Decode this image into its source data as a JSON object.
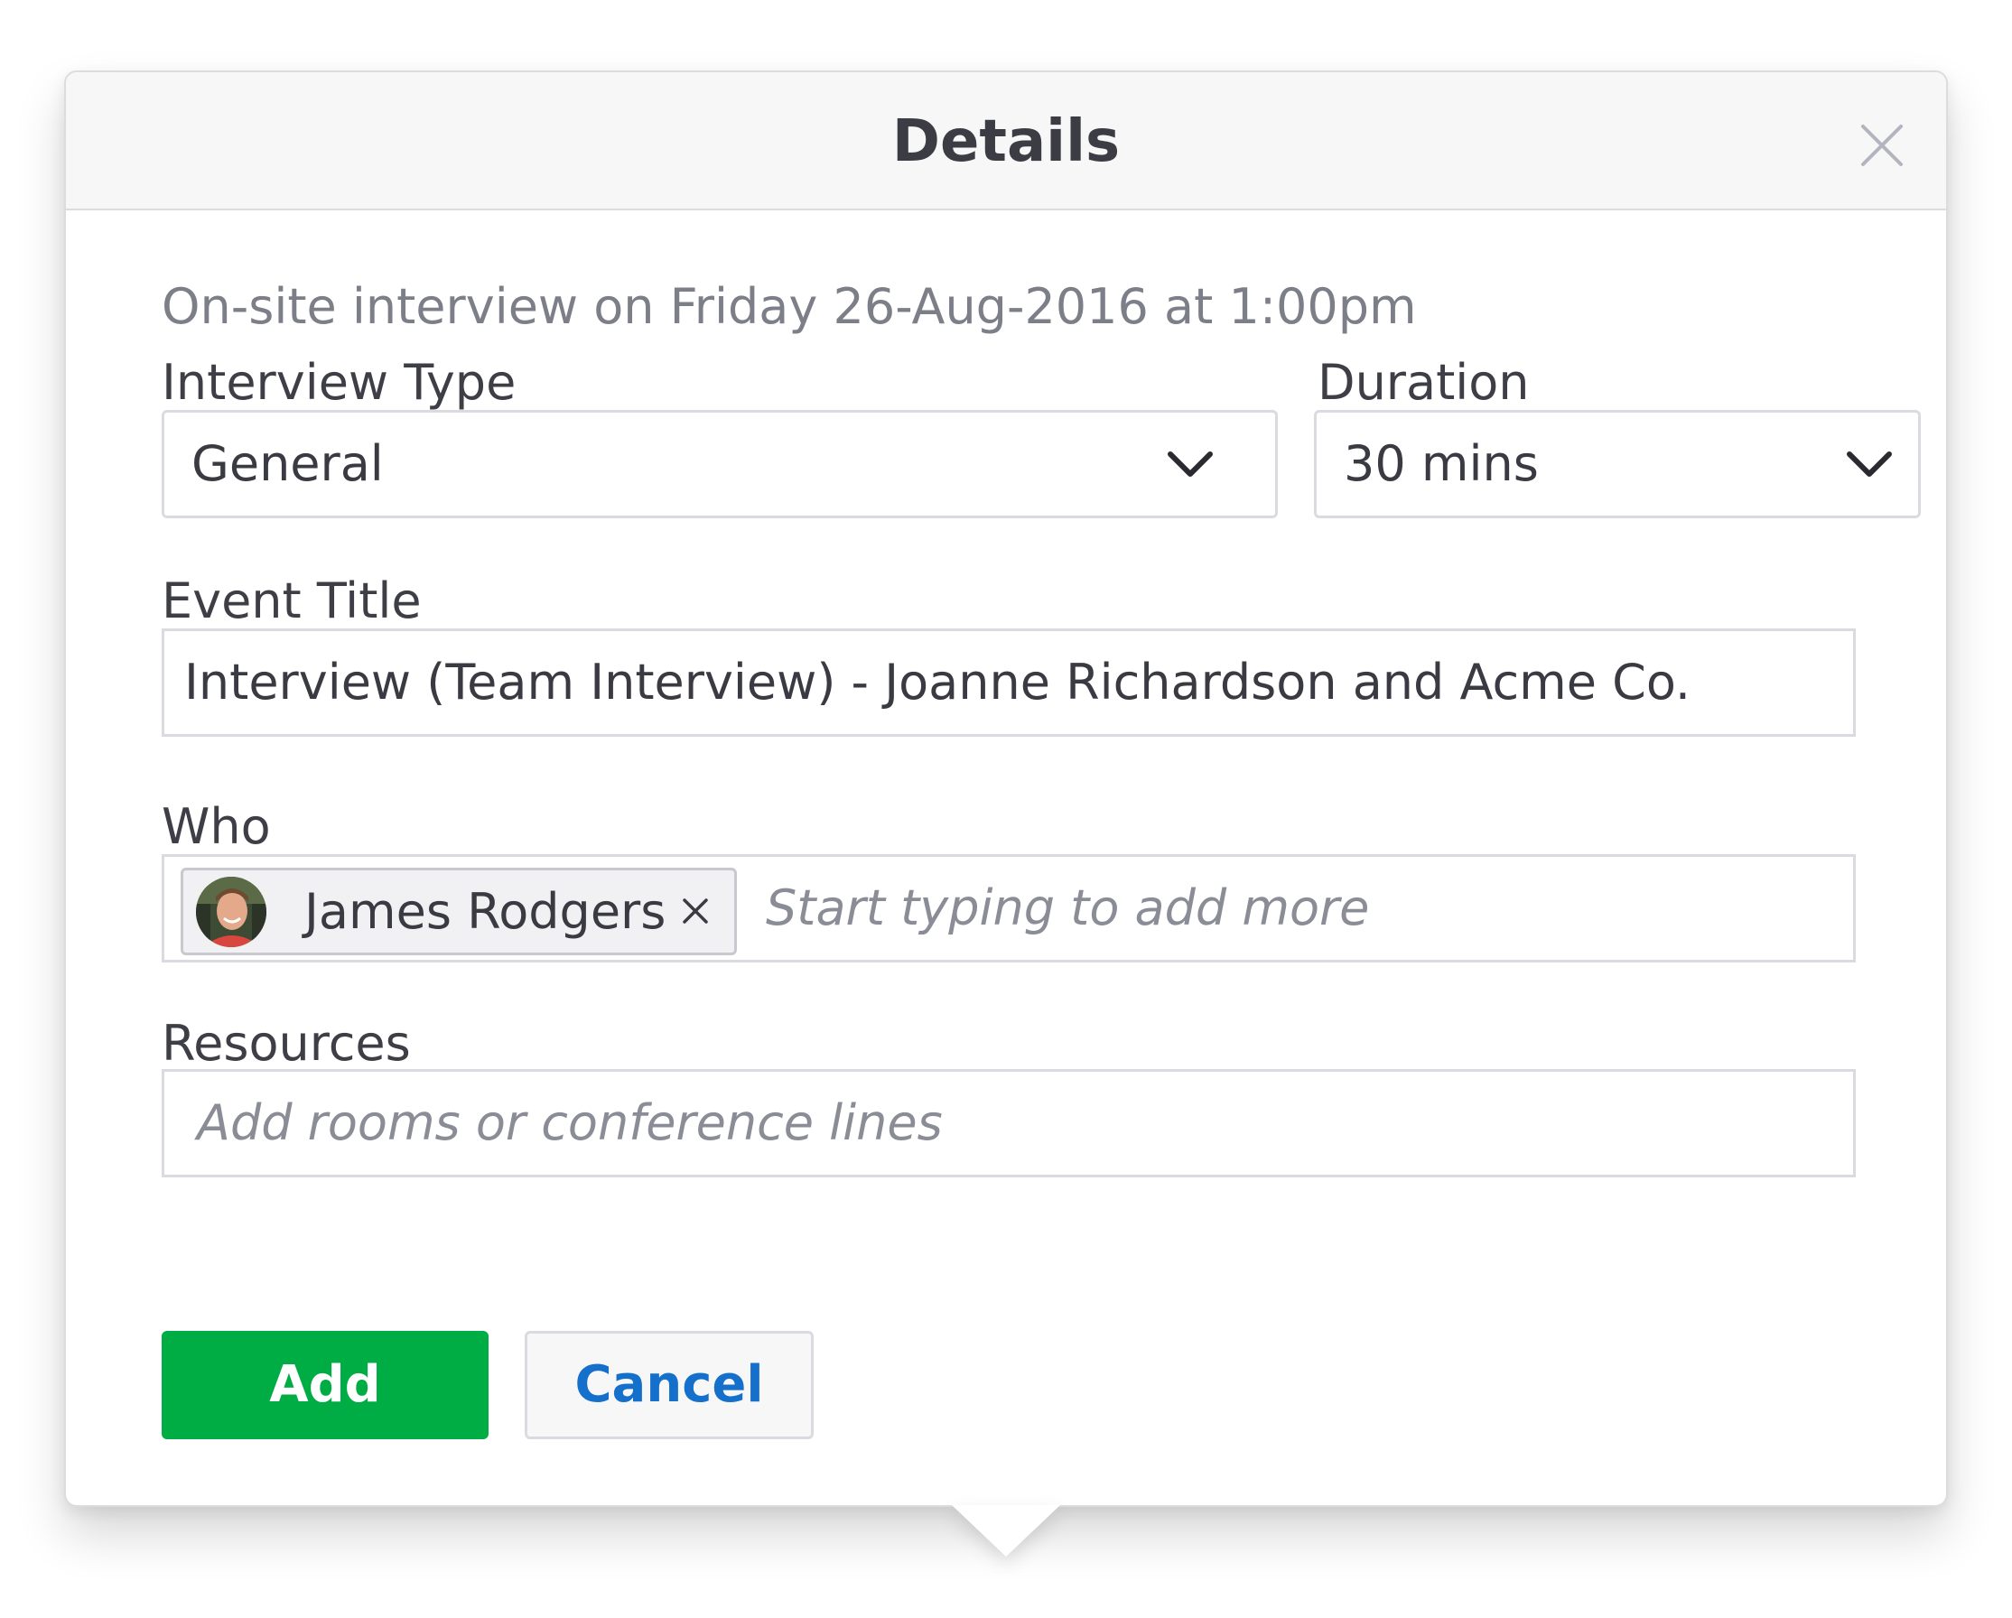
{
  "dialog": {
    "title": "Details",
    "close_icon": "close-icon"
  },
  "event_summary": "On-site interview on Friday 26-Aug-2016 at 1:00pm",
  "interview_type": {
    "label": "Interview Type",
    "selected": "General",
    "icon": "chevron-down-icon"
  },
  "duration": {
    "label": "Duration",
    "selected": "30 mins",
    "icon": "chevron-down-icon"
  },
  "event_title": {
    "label": "Event Title",
    "value": "Interview (Team Interview) - Joanne Richardson and Acme Co."
  },
  "who": {
    "label": "Who",
    "attendees": [
      {
        "name": "James Rodgers",
        "avatar_icon": "avatar"
      }
    ],
    "remove_icon": "remove-icon",
    "placeholder": "Start typing to add more"
  },
  "resources": {
    "label": "Resources",
    "placeholder": "Add rooms or conference lines"
  },
  "actions": {
    "add_label": "Add",
    "cancel_label": "Cancel"
  },
  "colors": {
    "primary_button": "#00ad45",
    "link_blue": "#1570cc",
    "header_bg": "#f7f7f8",
    "border": "#dadbe0"
  }
}
